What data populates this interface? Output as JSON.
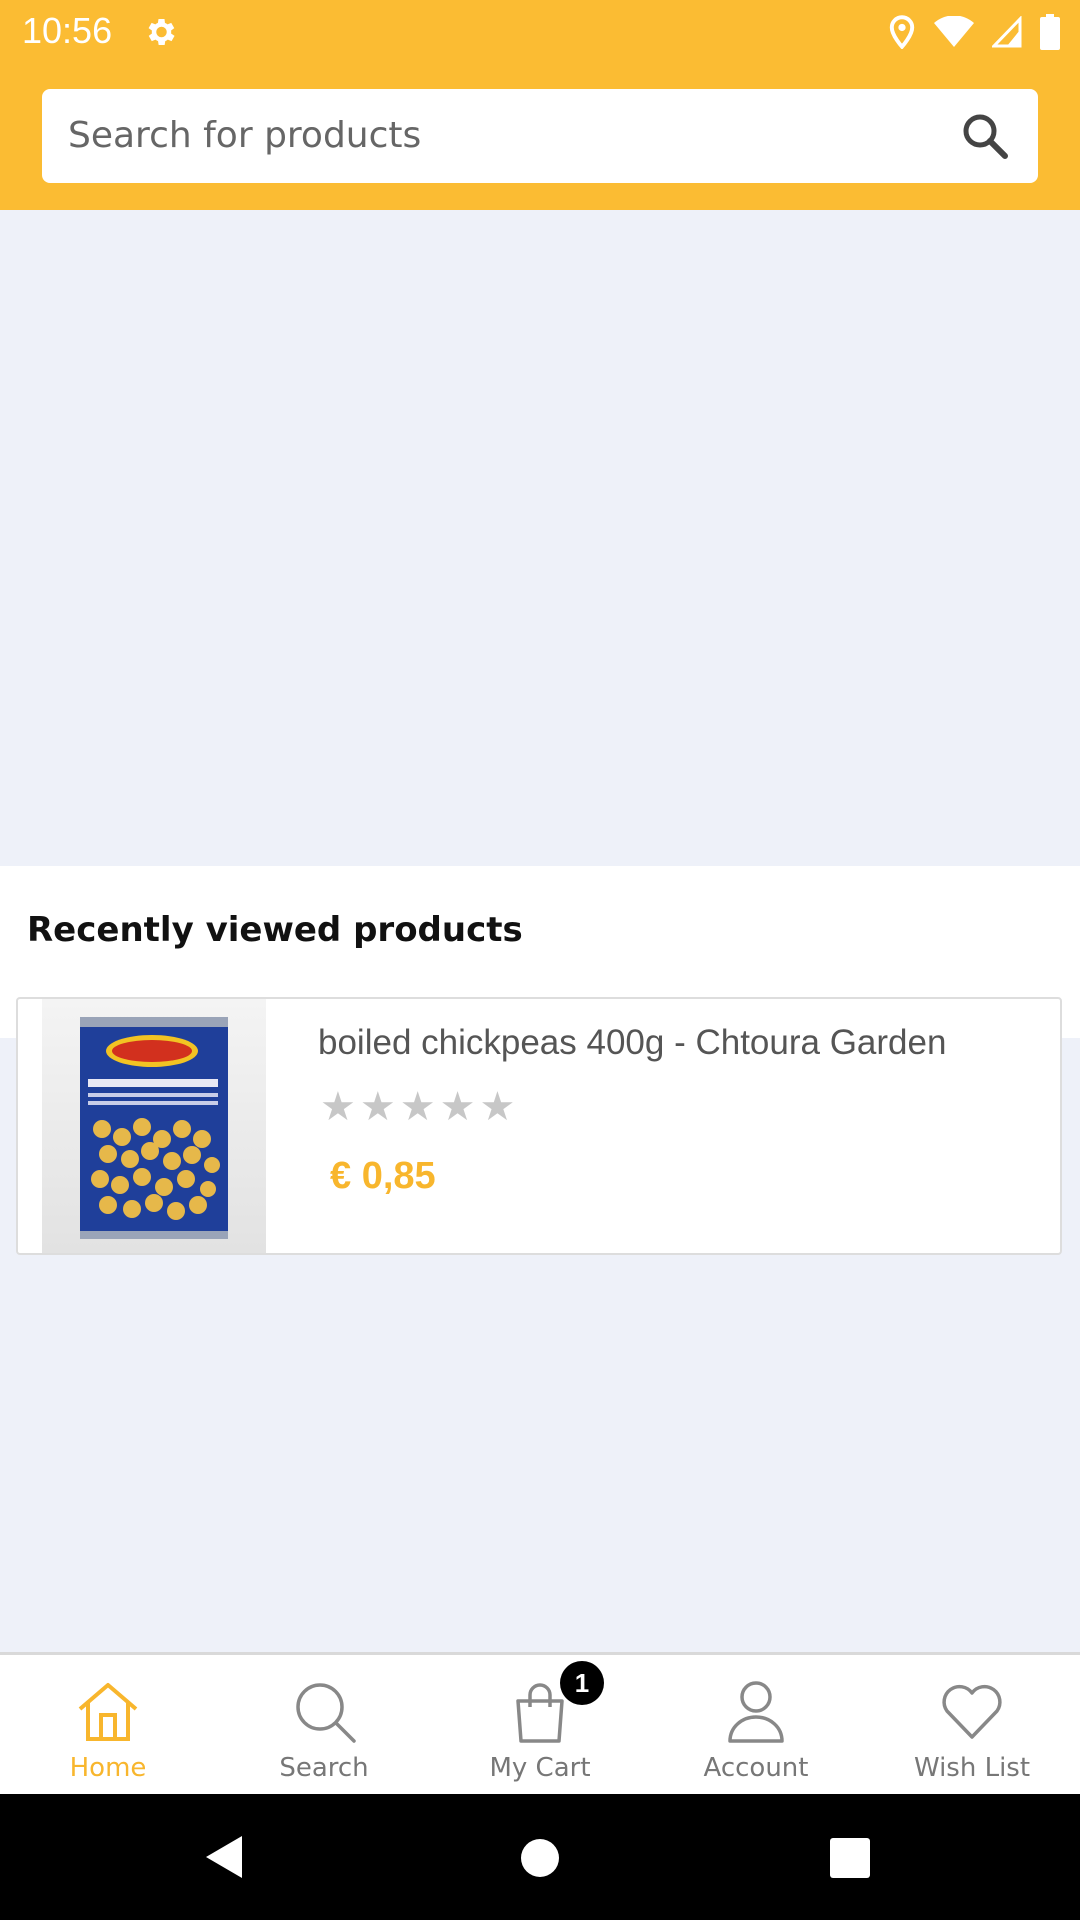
{
  "status_bar": {
    "time": "10:56",
    "icons": [
      "gear-icon",
      "location-icon",
      "wifi-icon",
      "signal-icon",
      "battery-icon"
    ]
  },
  "search": {
    "placeholder": "Search for products"
  },
  "recent": {
    "title": "Recently viewed products",
    "products": [
      {
        "name": "boiled chickpeas 400g - Chtoura Garden",
        "rating": 0,
        "max_rating": 5,
        "price": "€ 0,85"
      }
    ]
  },
  "bottom_nav": {
    "items": [
      {
        "label": "Home",
        "icon": "home-icon",
        "active": true
      },
      {
        "label": "Search",
        "icon": "search-icon",
        "active": false
      },
      {
        "label": "My Cart",
        "icon": "cart-icon",
        "active": false,
        "badge": "1"
      },
      {
        "label": "Account",
        "icon": "account-icon",
        "active": false
      },
      {
        "label": "Wish List",
        "icon": "heart-icon",
        "active": false
      }
    ]
  },
  "colors": {
    "brand": "#fbbc33",
    "price": "#f8b62d",
    "background": "#eef1f9"
  }
}
